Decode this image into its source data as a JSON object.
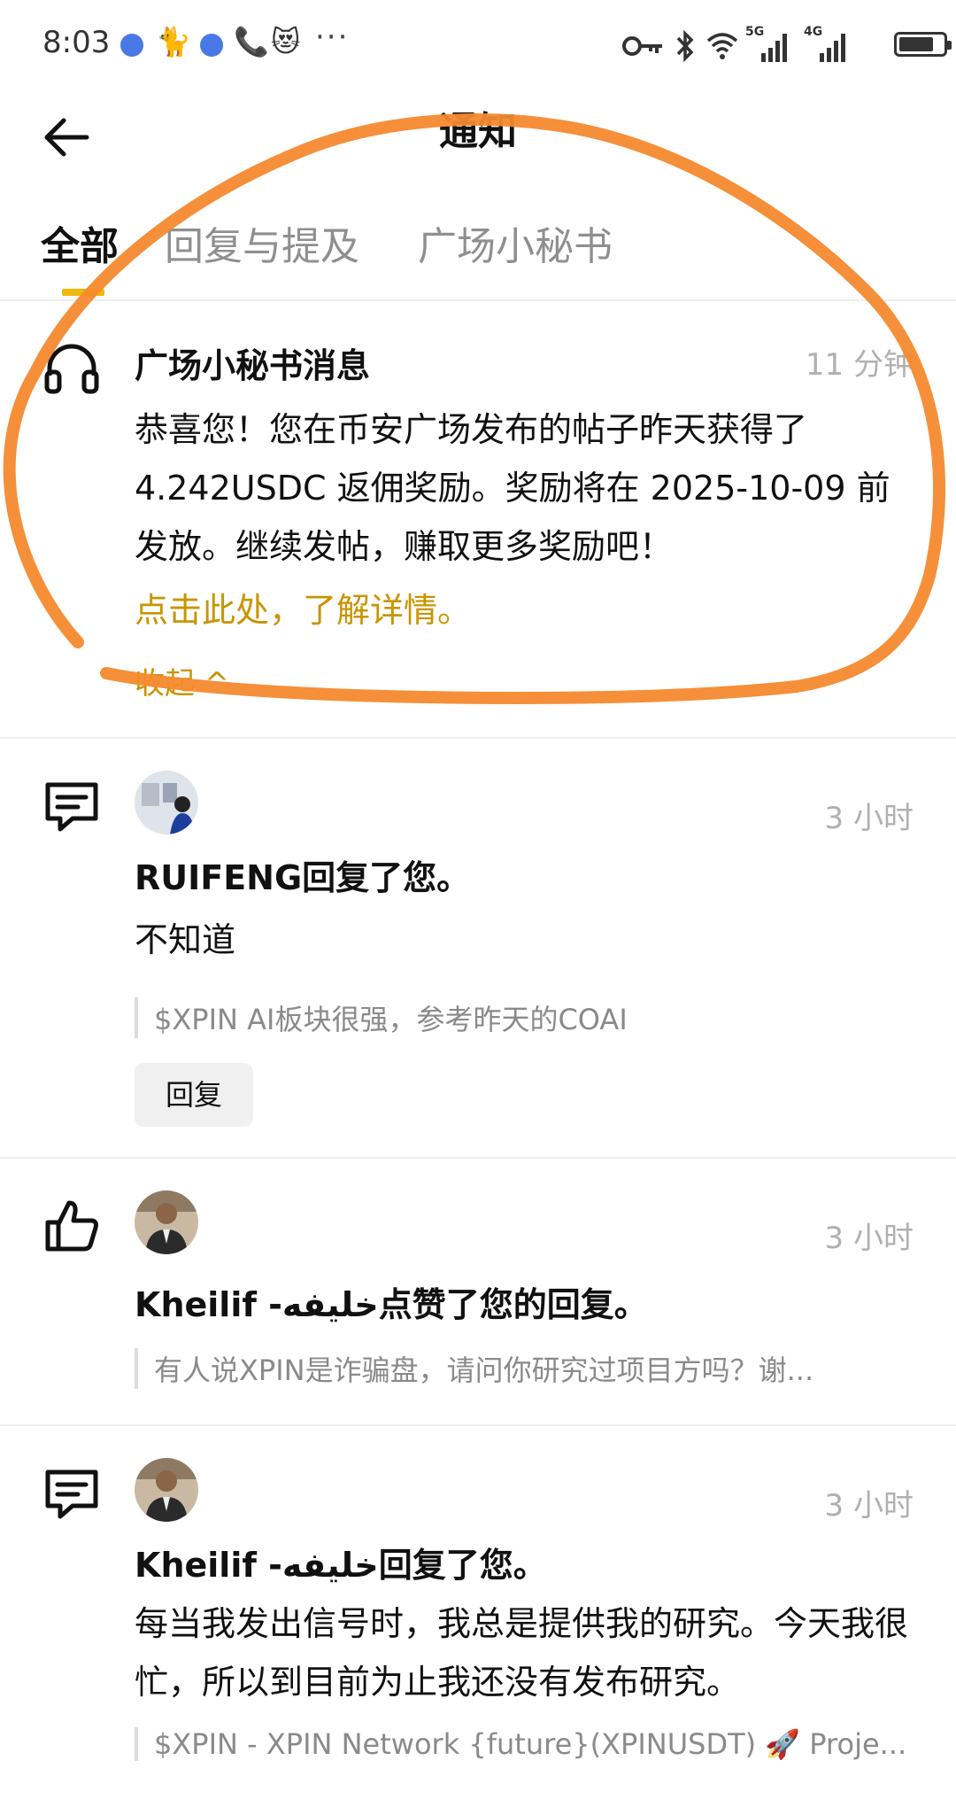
{
  "status_bar": {
    "time": "8:03",
    "more": "···",
    "net1": "5G",
    "net2": "4G"
  },
  "header": {
    "title": "通知",
    "back_icon": "arrow-left-icon"
  },
  "tabs": [
    {
      "label": "全部",
      "active": true
    },
    {
      "label": "回复与提及",
      "active": false
    },
    {
      "label": "广场小秘书",
      "active": false
    }
  ],
  "notifications": [
    {
      "icon": "headphones-icon",
      "heading": "广场小秘书消息",
      "time": "11 分钟",
      "body": "恭喜您！您在币安广场发布的帖子昨天获得了 4.242USDC 返佣奖励。奖励将在 2025-10-09 前发放。继续发帖，赚取更多奖励吧！",
      "link": "点击此处，了解详情。",
      "collapse": "收起 ^"
    },
    {
      "icon": "comment-icon",
      "time": "3 小时",
      "heading": "RUIFENG回复了您。",
      "body": "不知道",
      "quote": "$XPIN AI板块很强，参考昨天的COAI",
      "reply_button": "回复"
    },
    {
      "icon": "thumbs-up-icon",
      "time": "3 小时",
      "heading": "Kheilif -خليفه点赞了您的回复。",
      "quote": "有人说XPIN是诈骗盘，请问你研究过项目方吗？谢..."
    },
    {
      "icon": "comment-icon",
      "time": "3 小时",
      "heading": "Kheilif -خليفه回复了您。",
      "body": "每当我发出信号时，我总是提供我的研究。今天我很忙，所以到目前为止我还没有发布研究。",
      "quote": "$XPIN - XPIN Network {future}(XPINUSDT) 🚀 Proje..."
    }
  ],
  "colors": {
    "accent": "#f0b90b",
    "link": "#c99400",
    "annotation": "#f5892e"
  }
}
